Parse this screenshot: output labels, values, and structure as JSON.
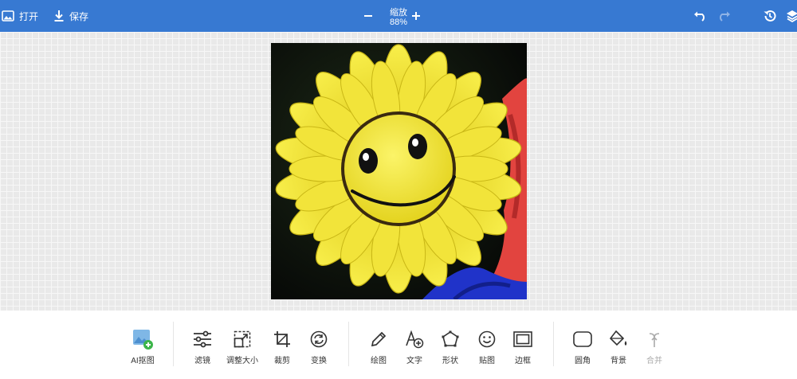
{
  "topbar": {
    "open_label": "打开",
    "save_label": "保存",
    "zoom_label": "缩放",
    "zoom_value": "88%",
    "accent": "#3779d2"
  },
  "icons": {
    "open": "image-icon",
    "save": "download-icon",
    "undo": "undo-icon",
    "redo": "redo-icon",
    "history": "history-icon",
    "layers": "layers-icon"
  },
  "toolbar": {
    "groups": [
      [
        {
          "label": "AI抠图",
          "icon": "ai-cutout-icon"
        }
      ],
      [
        {
          "label": "滤镜",
          "icon": "sliders-icon"
        },
        {
          "label": "调整大小",
          "icon": "resize-icon"
        },
        {
          "label": "裁剪",
          "icon": "crop-icon"
        },
        {
          "label": "变换",
          "icon": "transform-icon"
        }
      ],
      [
        {
          "label": "绘图",
          "icon": "pencil-icon"
        },
        {
          "label": "文字",
          "icon": "text-icon"
        },
        {
          "label": "形状",
          "icon": "shape-icon"
        },
        {
          "label": "贴图",
          "icon": "sticker-icon"
        },
        {
          "label": "边框",
          "icon": "frame-icon"
        }
      ],
      [
        {
          "label": "圆角",
          "icon": "rounded-corner-icon"
        },
        {
          "label": "背景",
          "icon": "fill-bucket-icon"
        },
        {
          "label": "合并",
          "icon": "merge-icon",
          "disabled": true
        }
      ]
    ]
  }
}
